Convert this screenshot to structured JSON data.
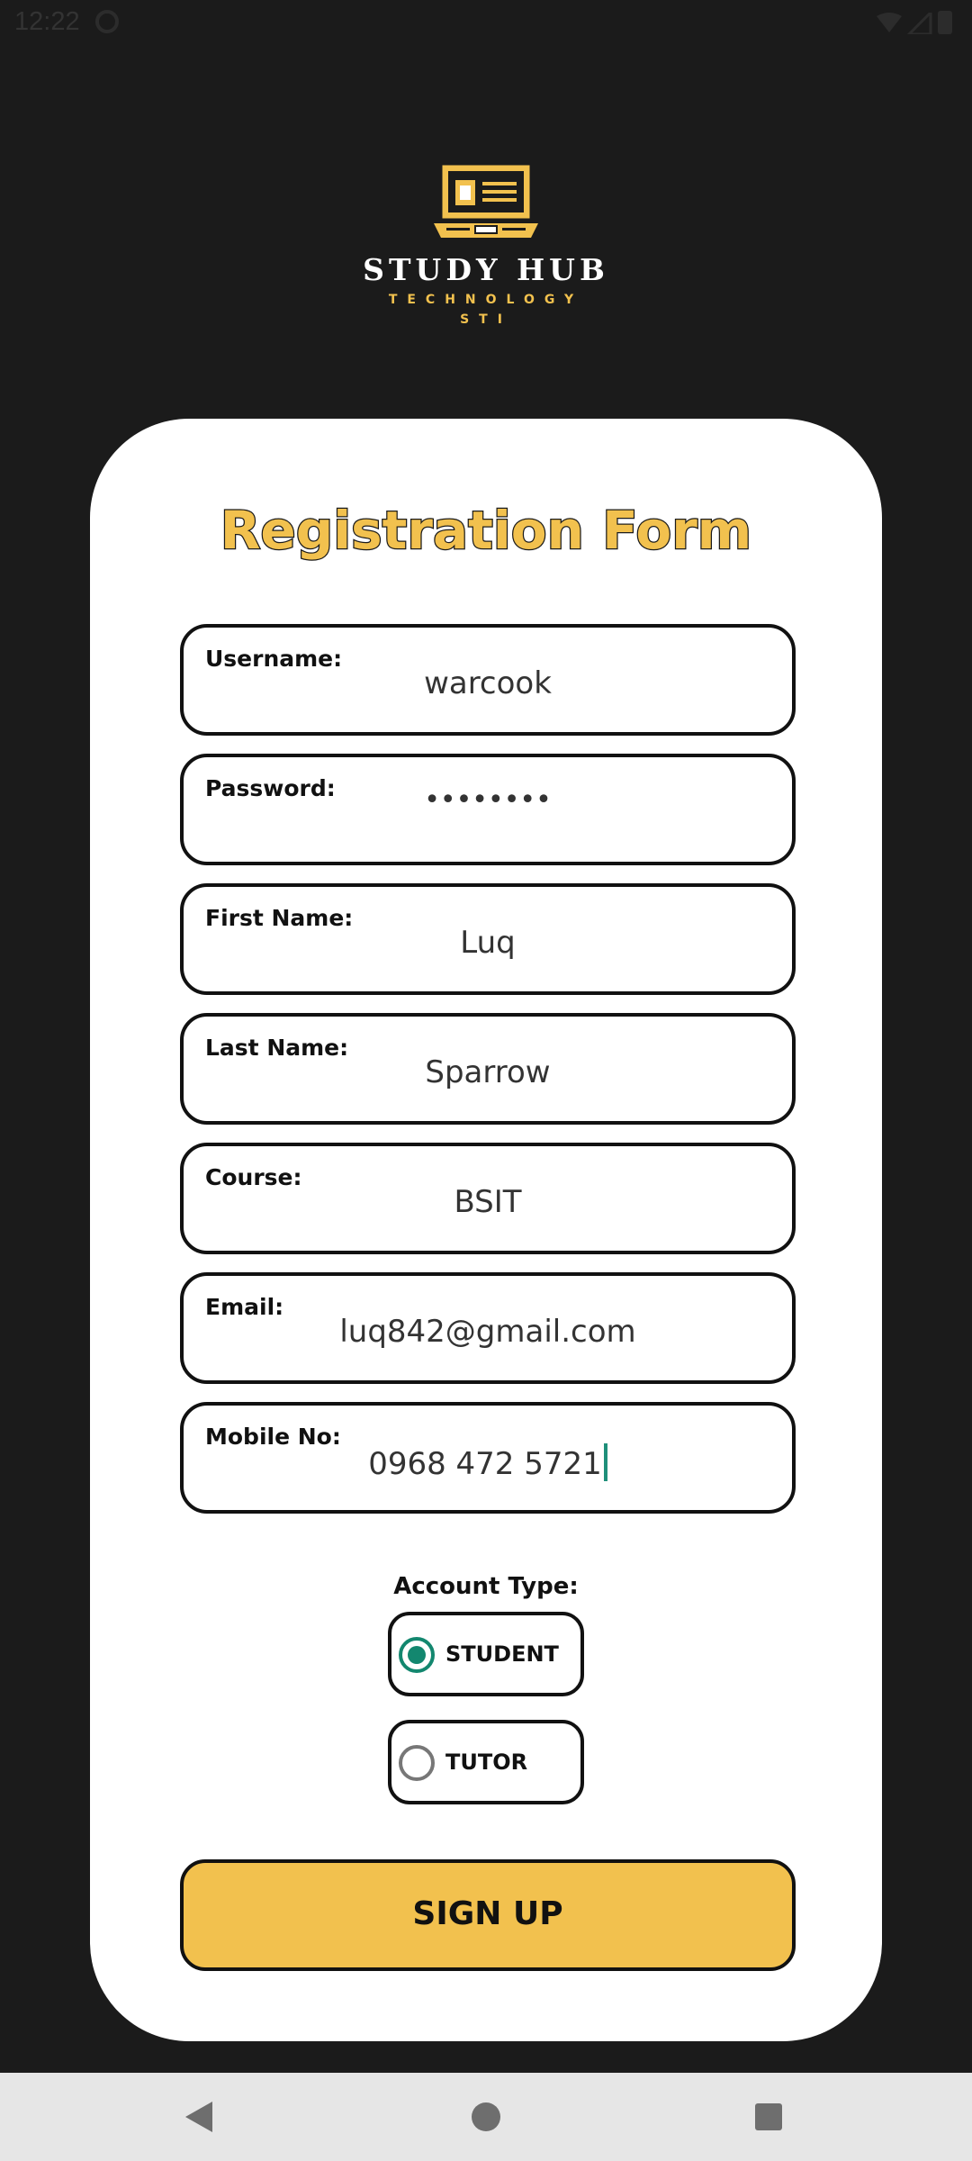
{
  "status_bar": {
    "time": "12:22"
  },
  "logo": {
    "title": "STUDY HUB",
    "subtitle": "TECHNOLOGY",
    "subtitle2": "STI"
  },
  "form": {
    "title": "Registration Form",
    "fields": [
      {
        "label": "Username:",
        "value": "warcook"
      },
      {
        "label": "Password:",
        "value": "••••••••"
      },
      {
        "label": "First Name:",
        "value": "Luq"
      },
      {
        "label": "Last Name:",
        "value": "Sparrow"
      },
      {
        "label": "Course:",
        "value": "BSIT"
      },
      {
        "label": "Email:",
        "value": "luq842@gmail.com"
      },
      {
        "label": "Mobile No:",
        "value": "0968 472 5721"
      }
    ],
    "account_type_label": "Account Type:",
    "account_options": [
      {
        "label": "STUDENT",
        "selected": true
      },
      {
        "label": "TUTOR",
        "selected": false
      }
    ],
    "submit_label": "SIGN UP"
  },
  "colors": {
    "accent": "#f2c14e",
    "radio_selected": "#13876f",
    "background": "#1b1b1b"
  },
  "nav_bar": {
    "back_icon": "back-icon",
    "home_icon": "home-icon",
    "recents_icon": "recents-icon"
  }
}
